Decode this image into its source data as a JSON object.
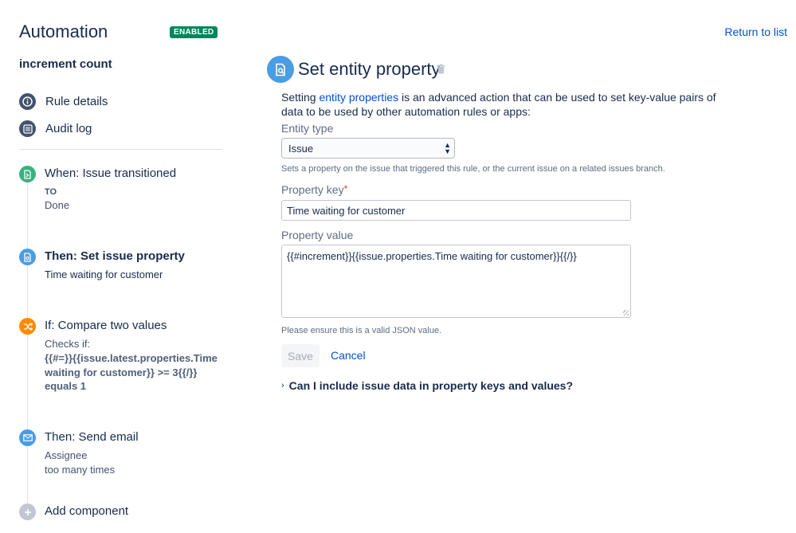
{
  "header": {
    "title": "Automation",
    "badge": "ENABLED",
    "return_link": "Return to list"
  },
  "sidebar": {
    "rule_name": "increment count",
    "nav": [
      {
        "label": "Rule details",
        "icon": "info-icon"
      },
      {
        "label": "Audit log",
        "icon": "list-icon"
      }
    ],
    "steps": [
      {
        "title": "When: Issue transitioned",
        "sub1": "TO",
        "sub2": "Done",
        "icon": "trigger-icon",
        "color": "#36b37e"
      },
      {
        "title": "Then: Set issue property",
        "sub1": "Time waiting for customer",
        "icon": "property-icon",
        "color": "#4a9de3"
      },
      {
        "title": "If: Compare two values",
        "sub1": "Checks if:",
        "sub2": "{{#=}}{{issue.latest.properties.Time waiting for customer}} >= 3{{/}}",
        "sub3": "equals 1",
        "icon": "shuffle-icon",
        "color": "#ff8b00"
      },
      {
        "title": "Then: Send email",
        "sub1": "Assignee",
        "sub2": "too many times",
        "icon": "mail-icon",
        "color": "#4a9de3"
      }
    ],
    "add_component": "Add component"
  },
  "panel": {
    "title": "Set entity property",
    "desc_prefix": "Setting ",
    "desc_link": "entity properties",
    "desc_suffix": " is an advanced action that can be used to set key-value pairs of data to be used by other automation rules or apps:",
    "entity_type_label": "Entity type",
    "entity_type_value": "Issue",
    "entity_type_help": "Sets a property on the issue that triggered this rule, or the current issue on a related issues branch.",
    "property_key_label": "Property key",
    "required_mark": "*",
    "property_key_value": "Time waiting for customer",
    "property_value_label": "Property value",
    "property_value_value": "{{#increment}}{{issue.properties.Time waiting for customer}}{{/}}",
    "property_value_help": "Please ensure this is a valid JSON value.",
    "save_label": "Save",
    "cancel_label": "Cancel",
    "faq_label": "Can I include issue data in property keys and values?"
  }
}
